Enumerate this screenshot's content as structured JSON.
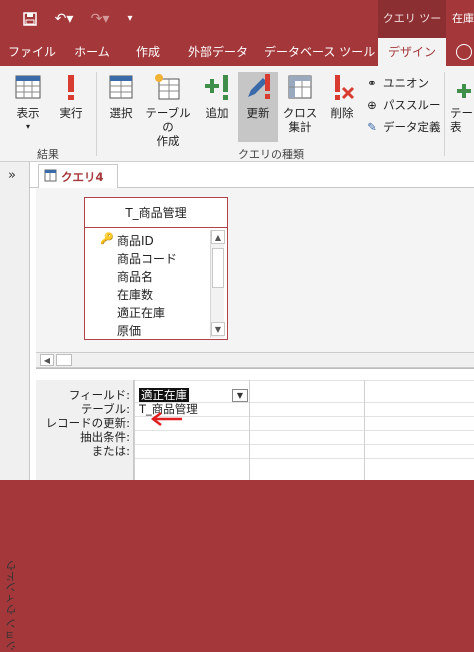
{
  "window": {
    "contextual_tab_title": "クエリ ツール",
    "title_tail": "在庫"
  },
  "quick_access": {
    "save_icon": "save-icon",
    "undo_icon": "undo-icon",
    "redo_icon": "redo-icon",
    "customize_icon": "customize-qat-icon"
  },
  "tabs": [
    "ファイル",
    "ホーム",
    "作成",
    "外部データ",
    "データベース ツール",
    "デザイン"
  ],
  "active_tab": "デザイン",
  "ribbon": {
    "results": {
      "view_label": "表示",
      "run_label": "実行",
      "group_label": "結果"
    },
    "query_type": {
      "select_label": "選択",
      "make_table_label_1": "テーブルの",
      "make_table_label_2": "作成",
      "append_label": "追加",
      "update_label": "更新",
      "crosstab_label_1": "クロス",
      "crosstab_label_2": "集計",
      "delete_label": "削除",
      "union_label": "ユニオン",
      "passthrough_label": "パススルー",
      "data_definition_label": "データ定義",
      "group_label": "クエリの種類"
    },
    "partial_next_1": "テー",
    "partial_next_2": "表"
  },
  "colors": {
    "accent": "#a4373a",
    "ribbon_bg": "#f3f3f3",
    "arrow": "#e02020"
  },
  "nav": {
    "expand_glyph": "»",
    "vertical_label": "ション ウィンドウ"
  },
  "document": {
    "tab_label": "クエリ4"
  },
  "table_box": {
    "title": "T_商品管理",
    "fields": [
      "商品ID",
      "商品コード",
      "商品名",
      "在庫数",
      "適正在庫",
      "原価"
    ]
  },
  "grid": {
    "row_labels": [
      "フィールド:",
      "テーブル:",
      "レコードの更新:",
      "抽出条件:",
      "または:"
    ],
    "field_value": "適正在庫",
    "table_value": "T_商品管理"
  }
}
